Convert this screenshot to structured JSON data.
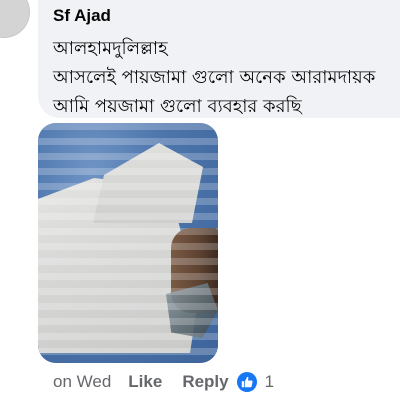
{
  "comment": {
    "author": "Sf Ajad",
    "lines": [
      "আলহামদুলিল্লাহ",
      "আসলেই  পায়জামা গুলো অনেক আরামদায়ক",
      "আমি পয়জামা গুলো ব্যবহার করছি"
    ],
    "timestamp": "on Wed",
    "like_label": "Like",
    "reply_label": "Reply",
    "reaction_icon": "thumbs-up-icon",
    "reaction_count": "1"
  },
  "colors": {
    "bubble_bg": "#f0f2f5",
    "text_primary": "#050505",
    "text_secondary": "#65676b",
    "like_blue": "#1877f2"
  }
}
